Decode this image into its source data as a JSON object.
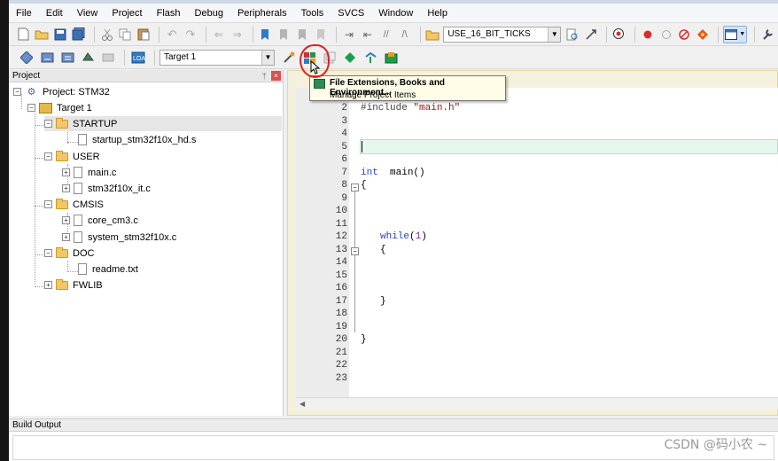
{
  "menubar": {
    "items": [
      "File",
      "Edit",
      "View",
      "Project",
      "Flash",
      "Debug",
      "Peripherals",
      "Tools",
      "SVCS",
      "Window",
      "Help"
    ]
  },
  "toolbar1": {
    "define_combo": "USE_16_BIT_TICKS",
    "icons": [
      "new-file-icon",
      "open-file-icon",
      "save-icon",
      "save-all-icon",
      "cut-icon",
      "copy-icon",
      "paste-icon",
      "undo-icon",
      "redo-icon",
      "navigate-back-icon",
      "navigate-forward-icon",
      "insert-bookmark-icon",
      "previous-bookmark-icon",
      "next-bookmark-icon",
      "clear-bookmarks-icon",
      "indent-icon",
      "unindent-icon",
      "comment-icon",
      "uncomment-icon",
      "find-in-files-icon",
      "find-icon",
      "incremental-find-icon",
      "debug-session-icon",
      "insert-breakpoint-icon",
      "enable-breakpoint-icon",
      "disable-breakpoints-icon",
      "kill-breakpoints-icon",
      "window-layout-icon",
      "configuration-icon"
    ]
  },
  "toolbar2": {
    "target_combo": "Target 1",
    "icons": [
      "translate-icon",
      "build-icon",
      "rebuild-icon",
      "batch-build-icon",
      "stop-build-icon",
      "download-icon",
      "target-options-icon",
      "manage-project-items-icon",
      "manage-rte-icon",
      "select-packs-icon",
      "pack-installer-icon"
    ]
  },
  "tooltip": {
    "title": "File Extensions, Books and Environment...",
    "subtitle": "Manage Project Items"
  },
  "project": {
    "title": "Project",
    "tree": {
      "root": "Project: STM32",
      "target": "Target 1",
      "groups": [
        {
          "name": "STARTUP",
          "files": [
            "startup_stm32f10x_hd.s"
          ]
        },
        {
          "name": "USER",
          "files": [
            "main.c",
            "stm32f10x_it.c"
          ]
        },
        {
          "name": "CMSIS",
          "files": [
            "core_cm3.c",
            "system_stm32f10x.c"
          ]
        },
        {
          "name": "DOC",
          "files": [
            "readme.txt"
          ]
        },
        {
          "name": "FWLIB",
          "files": []
        }
      ]
    }
  },
  "editor": {
    "line_numbers": [
      "2",
      "3",
      "4",
      "5",
      "6",
      "7",
      "8",
      "9",
      "10",
      "11",
      "12",
      "13",
      "14",
      "15",
      "16",
      "17",
      "18",
      "19",
      "20",
      "21",
      "22",
      "23"
    ],
    "code": {
      "include_kw": "#include",
      "include_file": "\"main.h\"",
      "int_kw": "int",
      "main_sig": "main()",
      "open_brace": "{",
      "while_kw": "while",
      "while_arg_open": "(",
      "while_num": "1",
      "while_arg_close": ")",
      "inner_open": "{",
      "inner_close": "}",
      "outer_close": "}"
    }
  },
  "build_output": {
    "title": "Build Output"
  },
  "watermark": "CSDN @码小农 ~",
  "colors": {
    "keyword": "#2b3ec6",
    "string": "#a31515",
    "number": "#8d1a8f",
    "highlight_circle": "#e0201e",
    "current_line": "#e7f7ee"
  }
}
